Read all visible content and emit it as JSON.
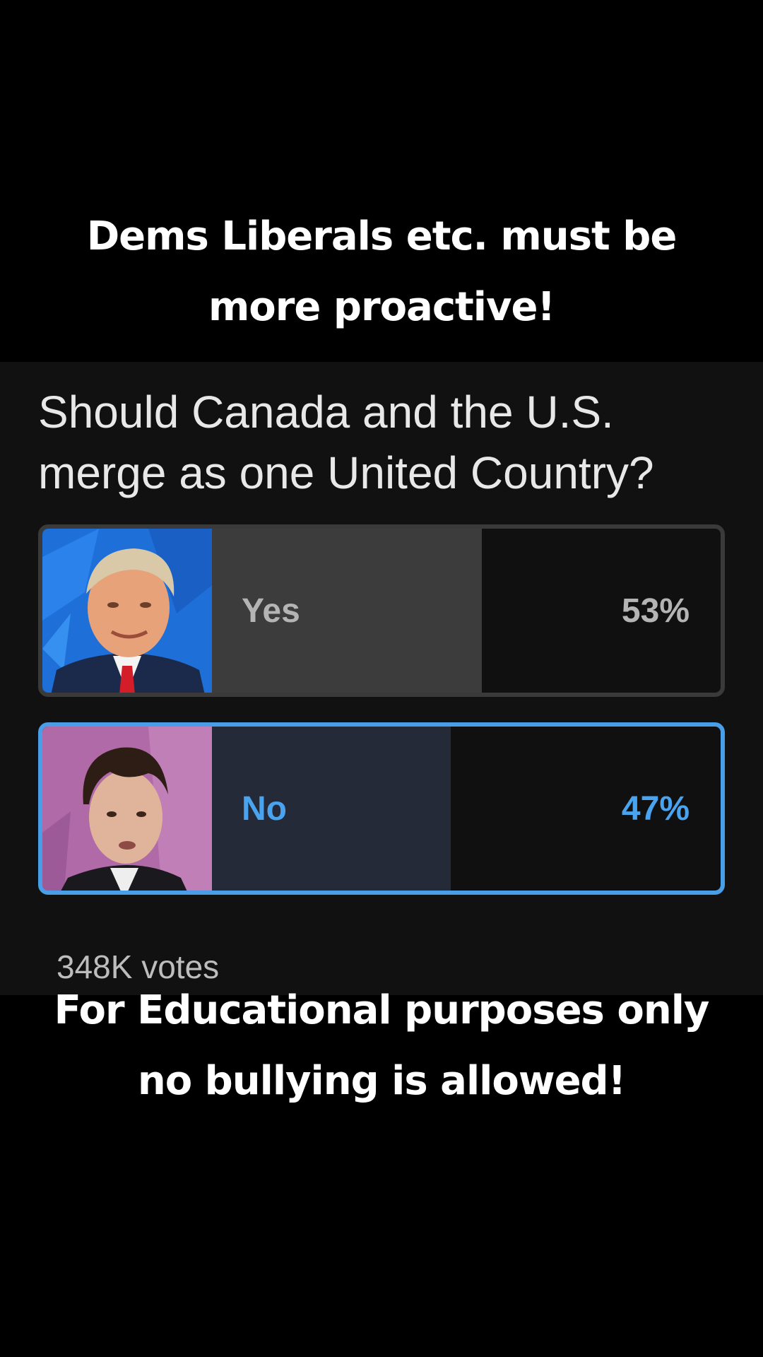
{
  "caption_top": {
    "lines": [
      "Dems Liberals etc. must be",
      "more proactive!"
    ]
  },
  "poll": {
    "question_lines": [
      "Should Canada and the U.S.",
      "merge as one United Country?"
    ],
    "options": [
      {
        "label": "Yes",
        "percent_text": "53%",
        "percent": 53,
        "selected": false,
        "photo": "man-blue-background-red-tie-photo"
      },
      {
        "label": "No",
        "percent_text": "47%",
        "percent": 47,
        "selected": true,
        "photo": "man-pink-background-photo"
      }
    ],
    "votes": "348K votes"
  },
  "caption_bottom": {
    "lines": [
      "For Educational purposes only",
      "no bullying is allowed!"
    ]
  },
  "colors": {
    "background": "#000000",
    "card": "#111111",
    "accent_selected": "#4a9ee8",
    "yes_fill": "#3c3c3c",
    "no_fill": "#242a38"
  }
}
